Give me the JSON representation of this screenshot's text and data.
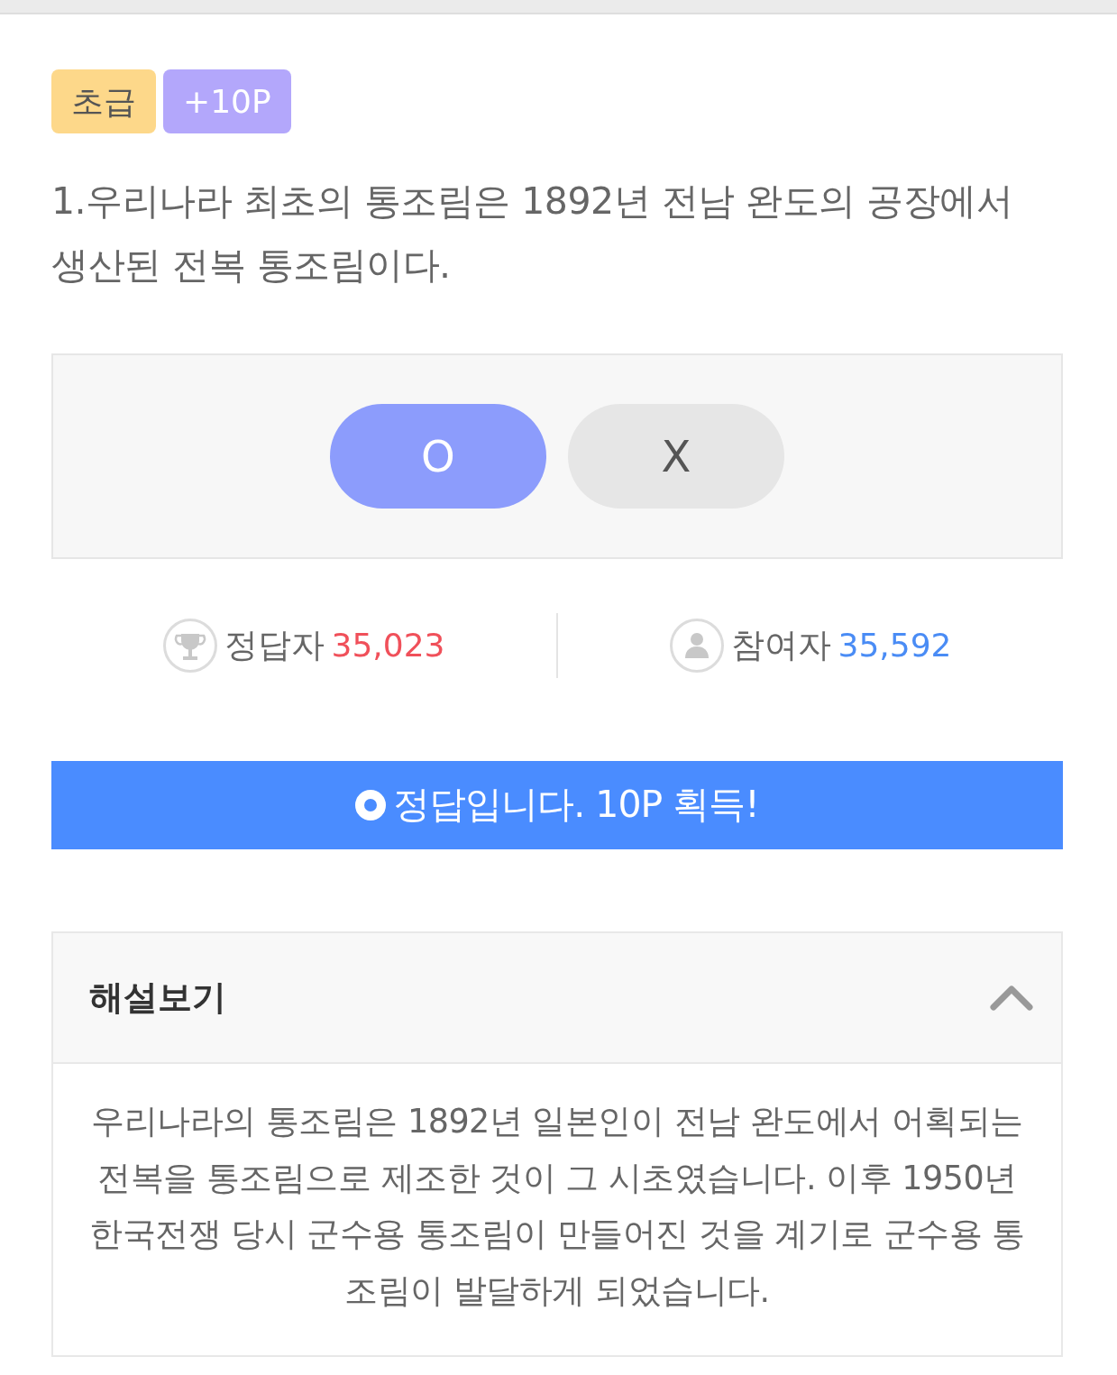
{
  "badges": [
    {
      "kind": "level",
      "label": "초급"
    },
    {
      "kind": "points",
      "label": "+10P"
    }
  ],
  "question": "1.우리나라 최초의 통조림은 1892년 전남 완도의 공장에서 생산된 전복 통조림이다.",
  "answers": [
    {
      "label": "O",
      "selected": true
    },
    {
      "label": "X",
      "selected": false
    }
  ],
  "stats": [
    {
      "kind": "correct",
      "label": "정답자",
      "count": "35,023"
    },
    {
      "kind": "participants",
      "label": "참여자",
      "count": "35,592"
    }
  ],
  "result": {
    "kind": "correct",
    "message": "정답입니다. 10P 획득!"
  },
  "explanation": {
    "title": "해설보기",
    "expanded": true,
    "text": "우리나라의 통조림은 1892년 일본인이 전남 완도에서 어획되는 전복을 통조림으로 제조한 것이 그 시초였습니다. 이후 1950년 한국전쟁 당시 군수용 통조림이 만들어진 것을 계기로 군수용 통조림이 발달하게 되었습니다."
  }
}
